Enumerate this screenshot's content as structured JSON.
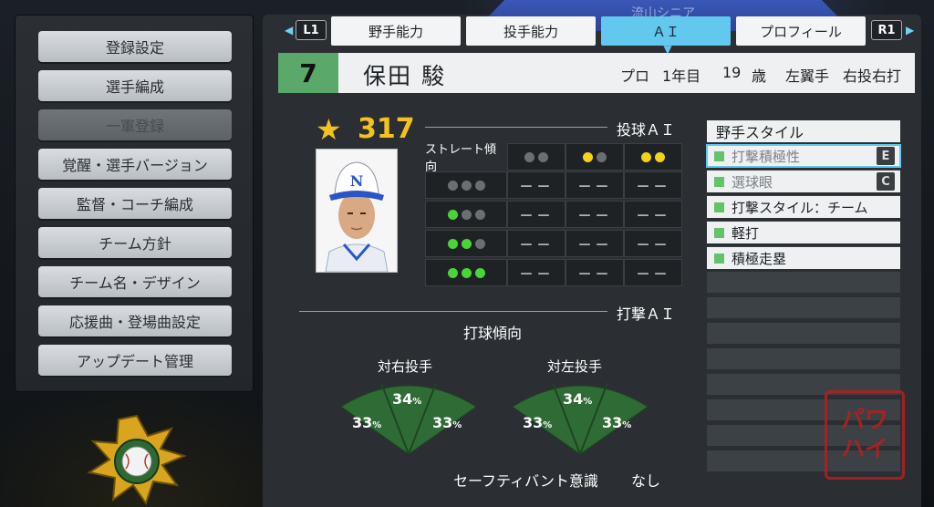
{
  "menu": {
    "items": [
      {
        "label": "登録設定",
        "enabled": true
      },
      {
        "label": "選手編成",
        "enabled": true
      },
      {
        "label": "一軍登録",
        "enabled": false
      },
      {
        "label": "覚醒・選手バージョン",
        "enabled": true
      },
      {
        "label": "監督・コーチ編成",
        "enabled": true
      },
      {
        "label": "チーム方針",
        "enabled": true
      },
      {
        "label": "チーム名・デザイン",
        "enabled": true
      },
      {
        "label": "応援曲・登場曲設定",
        "enabled": true
      },
      {
        "label": "アップデート管理",
        "enabled": true
      }
    ]
  },
  "header": {
    "team_name": "流山シニア",
    "left_key": "L1",
    "right_key": "R1",
    "tabs": [
      {
        "label": "野手能力",
        "active": false
      },
      {
        "label": "投手能力",
        "active": false
      },
      {
        "label": "ＡＩ",
        "active": true
      },
      {
        "label": "プロフィール",
        "active": false
      }
    ]
  },
  "player": {
    "number": "7",
    "name": "保田 駿",
    "status": "プロ",
    "year": "1年目",
    "age": "19",
    "age_unit": "歳",
    "position": "左翼手",
    "handedness": "右投右打",
    "rating": "317",
    "cap_letter": "N"
  },
  "pitching_ai": {
    "title": "投球ＡＩ",
    "row_header": "ストレート傾向",
    "empty_value": "－－",
    "colors": {
      "gray": "#6a6f74",
      "yellow": "#f2d21a",
      "green": "#49d43a"
    }
  },
  "batting_ai": {
    "title": "打撃ＡＩ",
    "subtitle": "打球傾向",
    "vs_right": {
      "label": "対右投手",
      "left": "33",
      "center": "34",
      "right": "33"
    },
    "vs_left": {
      "label": "対左投手",
      "left": "33",
      "center": "34",
      "right": "33"
    },
    "pct_unit": "%",
    "bunt_label": "セーフティバント意識",
    "bunt_value": "なし"
  },
  "fielder_style": {
    "title": "野手スタイル",
    "items": [
      {
        "label": "打撃積極性",
        "grade": "E",
        "dim": true,
        "selected": true
      },
      {
        "label": "選球眼",
        "grade": "C",
        "dim": true,
        "selected": false
      },
      {
        "label": "打撃スタイル：チーム",
        "grade": "",
        "dim": false,
        "selected": false
      },
      {
        "label": "軽打",
        "grade": "",
        "dim": false,
        "selected": false
      },
      {
        "label": "積極走塁",
        "grade": "",
        "dim": false,
        "selected": false
      }
    ]
  },
  "watermark": {
    "line1": "パワ",
    "line2": "ハイ"
  }
}
